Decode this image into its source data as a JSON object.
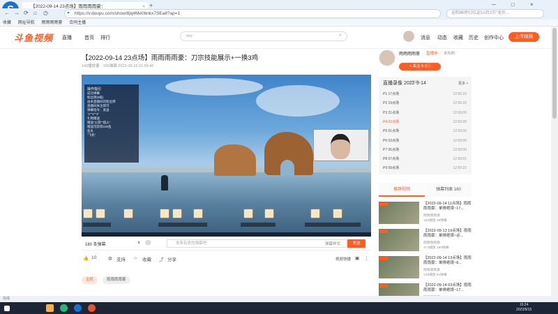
{
  "browser": {
    "logo": "S",
    "tab_title": "【2022-09-14 23点场】雨雨雨雨豪：",
    "url": "https://v.douyu.com/show/8jq4Me0bnkx7SEa8?ap=1",
    "search_placeholder": "迎和麻将归位迎10月3万\"无外...",
    "bookmarks": [
      "收藏",
      "网址导航",
      "雨雨雨雨豪",
      "合同主播"
    ]
  },
  "site": {
    "logo": "斗鱼视频",
    "nav": [
      "直播",
      "首页",
      "排行"
    ],
    "search_value": "ww",
    "user_nav": [
      "消息",
      "动态",
      "收藏",
      "历史",
      "创作中心"
    ],
    "upload_label": "上传视频"
  },
  "video": {
    "title": "【2022-09-14 23点场】雨雨雨雨豪：刀宗技能展示+一换3鸡",
    "meta": "143播放量 · 160弹幕    2022-09-15 01:50:42",
    "overlay_title": "操作指引",
    "overlay_lines": [
      "成功弹幕",
      "粉丝牌(9级)",
      "由本直播间的粉丝牌",
      "直播间关注即可",
      "弹幕指令：发送",
      "\"1\"\"2\"\"3\"",
      "礼物赠送",
      "赠送\"火箭\"\"超火\"",
      "赠送可获得100鱼",
      "鱼丸",
      "\"飞机\""
    ]
  },
  "controls": {
    "danmu_count": "160 条弹幕",
    "danmu_placeholder": "发条有爱的弹幕吧",
    "danmu_style": "弹幕样式",
    "send_label": "发送",
    "like_count": "10",
    "support_label": "支持",
    "collect_label": "收藏",
    "share_label": "分享",
    "shortcut_label": "视频快捷"
  },
  "tags": [
    "主机",
    "雨雨雨雨豪"
  ],
  "anchor": {
    "name": "雨雨雨雨豪",
    "live_label": "直播中",
    "fans_label": "未知粉",
    "follow_label": "+ 关注 6.3万"
  },
  "replay": {
    "heading": "直播录像 2022-9-14",
    "count": "(4/10)",
    "more": "更多 >",
    "episodes": [
      {
        "label": "P1 17点场",
        "duration": "12:50:22",
        "active": false
      },
      {
        "label": "P2 19点场",
        "duration": "12:50:22",
        "active": false
      },
      {
        "label": "P3 21点场",
        "duration": "12:50:00",
        "active": false
      },
      {
        "label": "P4 23点场",
        "duration": "12:50:00",
        "active": true
      },
      {
        "label": "P5 01点场",
        "duration": "12:50:00",
        "active": false
      },
      {
        "label": "P6 03点场",
        "duration": "12:50:00",
        "active": false
      },
      {
        "label": "P7 05点场",
        "duration": "12:50:00",
        "active": false
      },
      {
        "label": "P8 07点场",
        "duration": "12:50:01",
        "active": false
      },
      {
        "label": "P9 09点场",
        "duration": "12:50:22",
        "active": false
      }
    ]
  },
  "sidebar_tabs": [
    "推荐视频",
    "弹幕列表 160"
  ],
  "recommended": [
    {
      "title": "【2022-09-14 11点场】雨雨雨雨豪：单排绝境~17...",
      "author": "雨雨雨雨豪",
      "stats": "150播放   36弹幕"
    },
    {
      "title": "【2022-09-13 19点场】雨雨雨雨豪：单排绝境~必...",
      "author": "雨雨雨雨豪",
      "stats": "374播放   290弹幕"
    },
    {
      "title": "【2022-09-14 13点场】雨雨雨雨豪：单排绝境~8...",
      "author": "雨雨雨雨豪",
      "stats": "139播放   91弹幕"
    },
    {
      "title": "【2022-09-14 03点场】雨雨雨雨豪：单排绝境~17...",
      "author": "雨雨雨雨豪",
      "stats": "136播放   26弹幕"
    }
  ],
  "statusbar": "完成",
  "taskbar": {
    "time": "15:24",
    "date": "2022/9/15"
  },
  "colors": {
    "accent": "#ff5d23",
    "browser_blue": "#1a6fd6"
  }
}
